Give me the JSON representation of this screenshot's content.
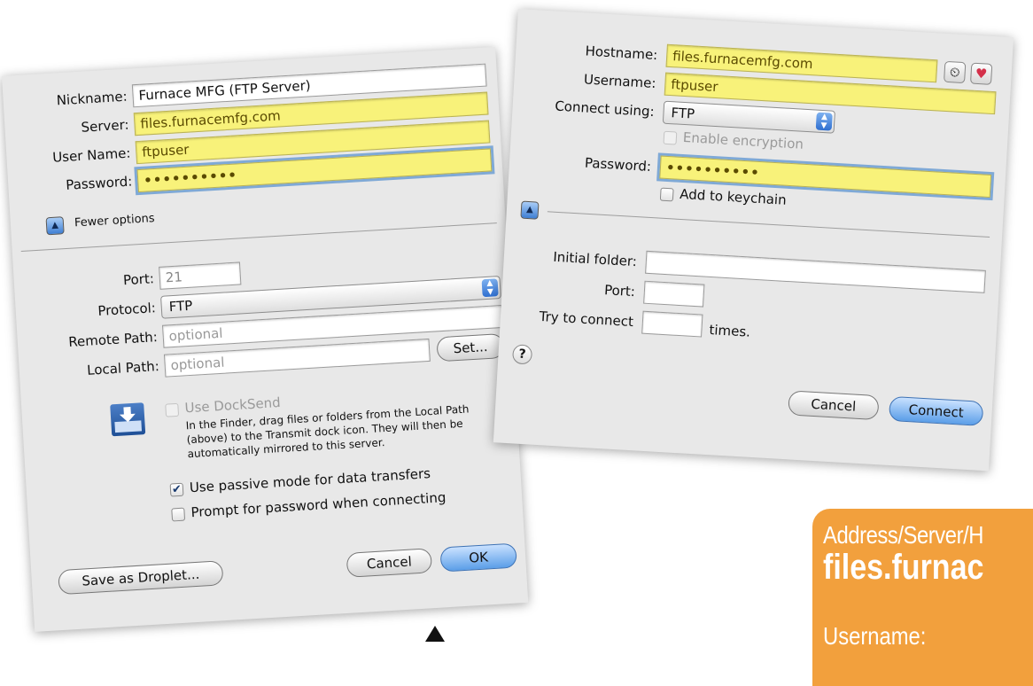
{
  "left_dialog": {
    "nickname_label": "Nickname:",
    "nickname_value": "Furnace MFG (FTP Server)",
    "server_label": "Server:",
    "server_value": "files.furnacemfg.com",
    "username_label": "User Name:",
    "username_value": "ftpuser",
    "password_label": "Password:",
    "password_mask": "••••••••••",
    "fewer_options_label": "Fewer options",
    "port_label": "Port:",
    "port_value": "21",
    "protocol_label": "Protocol:",
    "protocol_value": "FTP",
    "remote_path_label": "Remote Path:",
    "remote_path_placeholder": "optional",
    "local_path_label": "Local Path:",
    "local_path_placeholder": "optional",
    "set_button": "Set...",
    "docksend_label": "Use DockSend",
    "docksend_help": "In the Finder, drag files or folders from the Local Path (above) to the Transmit dock icon. They will then be automatically mirrored to this server.",
    "passive_mode_label": "Use passive mode for data transfers",
    "passive_mode_checked": true,
    "prompt_password_label": "Prompt for password when connecting",
    "prompt_password_checked": false,
    "save_droplet_button": "Save as Droplet...",
    "cancel_button": "Cancel",
    "ok_button": "OK"
  },
  "right_dialog": {
    "hostname_label": "Hostname:",
    "hostname_value": "files.furnacemfg.com",
    "username_label": "Username:",
    "username_value": "ftpuser",
    "connect_using_label": "Connect using:",
    "connect_using_value": "FTP",
    "enable_encryption_label": "Enable encryption",
    "password_label": "Password:",
    "password_mask": "••••••••••",
    "add_keychain_label": "Add to keychain",
    "initial_folder_label": "Initial folder:",
    "port_label": "Port:",
    "try_connect_label": "Try to connect",
    "times_label": "times.",
    "help_glyph": "?",
    "cancel_button": "Cancel",
    "connect_button": "Connect"
  },
  "note_card": {
    "line1": "Address/Server/H",
    "line2": "files.furnac",
    "line3": "Username:"
  }
}
